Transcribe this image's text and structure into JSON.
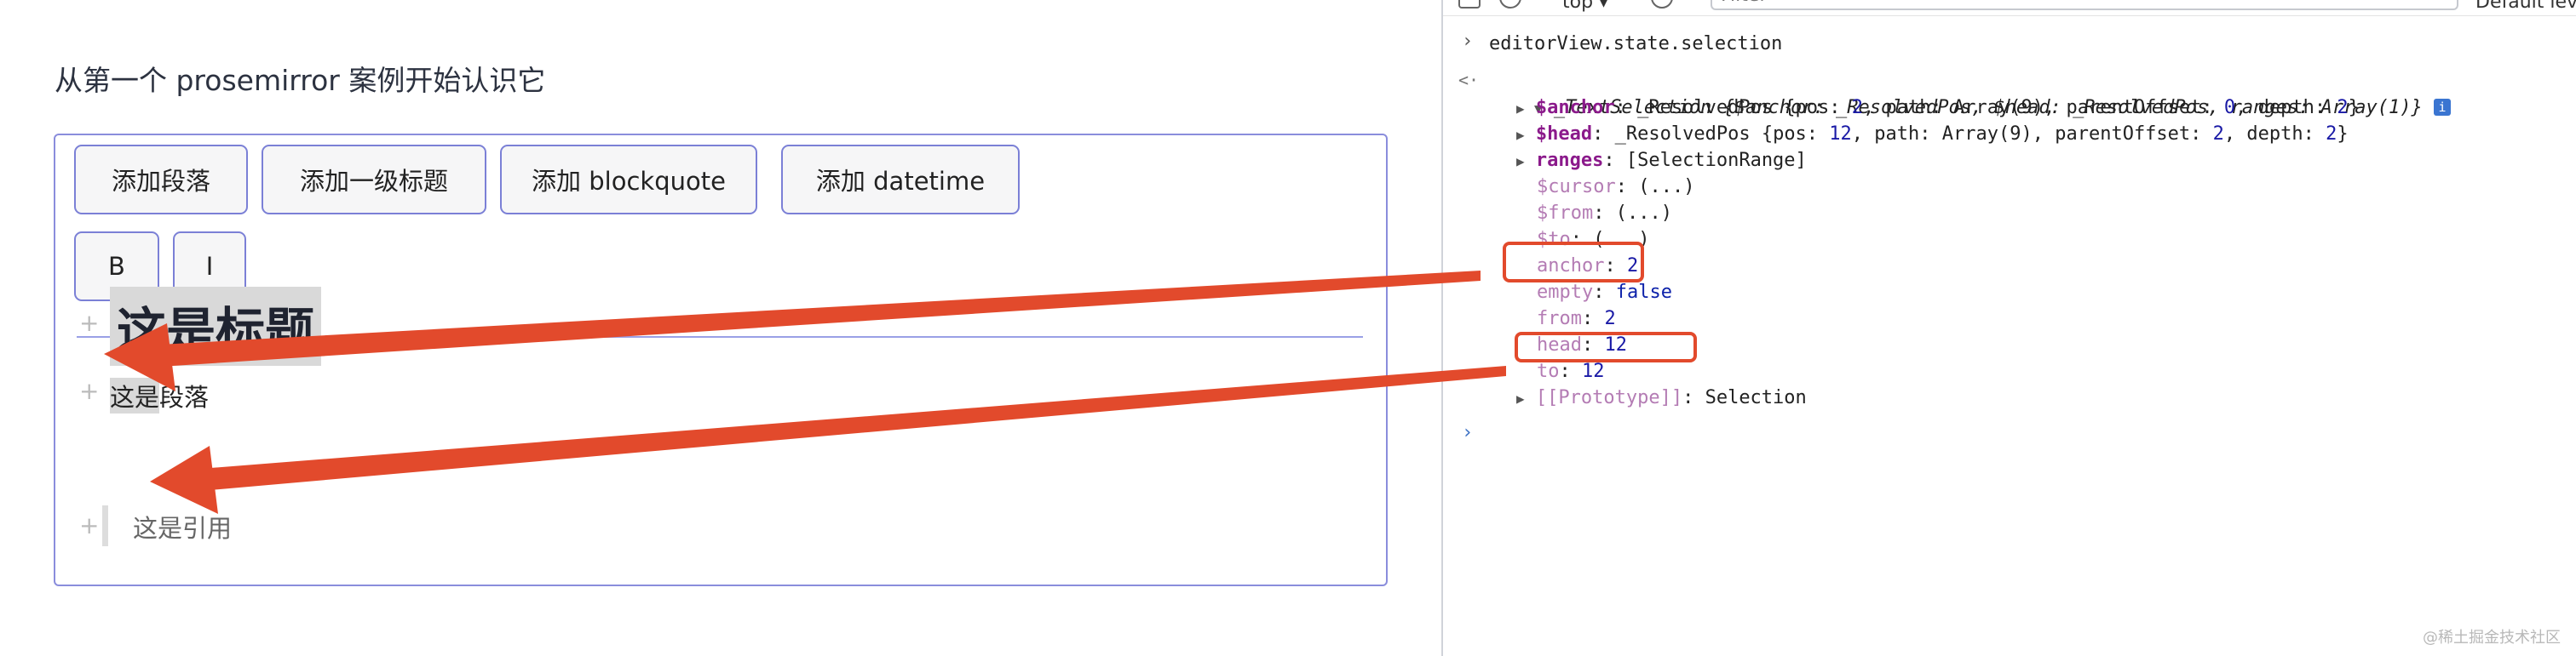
{
  "app": {
    "title": "从第一个 prosemirror 案例开始认识它",
    "toolbar": {
      "add_paragraph": "添加段落",
      "add_heading": "添加一级标题",
      "add_blockquote": "添加 blockquote",
      "add_datetime": "添加 datetime",
      "bold": "B",
      "italic": "I"
    },
    "doc": {
      "heading": "这是标题",
      "paragraph_selected": "这是",
      "paragraph_rest": "段落",
      "blockquote": "这是引用",
      "plus_glyph": "+"
    }
  },
  "devtools": {
    "toolbar": {
      "context": "top ▾",
      "filter_placeholder": "Filter",
      "levels": "Default levels"
    },
    "command": "editorView.state.selection",
    "result": {
      "summary_type": "_TextSelection",
      "summary_body": "{$anchor: _ResolvedPos, $head: _ResolvedPos, ranges: Array(1)}",
      "info_badge": "i",
      "anchor_resolved": {
        "key": "$anchor",
        "type": "_ResolvedPos",
        "pos": "2",
        "path": "Array(9)",
        "parentOffset": "0",
        "depth": "2"
      },
      "head_resolved": {
        "key": "$head",
        "type": "_ResolvedPos",
        "pos": "12",
        "path": "Array(9)",
        "parentOffset": "2",
        "depth": "2"
      },
      "ranges": {
        "key": "ranges",
        "value": "[SelectionRange]"
      },
      "cursor": {
        "key": "$cursor",
        "value": "(...)"
      },
      "from_lazy": {
        "key": "$from",
        "value": "(...)"
      },
      "to_lazy": {
        "key": "$to",
        "value": "(...)"
      },
      "anchor": {
        "key": "anchor",
        "value": "2"
      },
      "empty": {
        "key": "empty",
        "value": "false"
      },
      "from": {
        "key": "from",
        "value": "2"
      },
      "head": {
        "key": "head",
        "value": "12"
      },
      "to": {
        "key": "to",
        "value": "12"
      },
      "prototype": {
        "key": "[[Prototype]]",
        "value": "Selection"
      }
    }
  },
  "colors": {
    "arrow": "#e24a2c",
    "editor_border": "#8a8ddc",
    "selection_bg": "#d9d9d9"
  },
  "watermark": "@稀土掘金技术社区"
}
